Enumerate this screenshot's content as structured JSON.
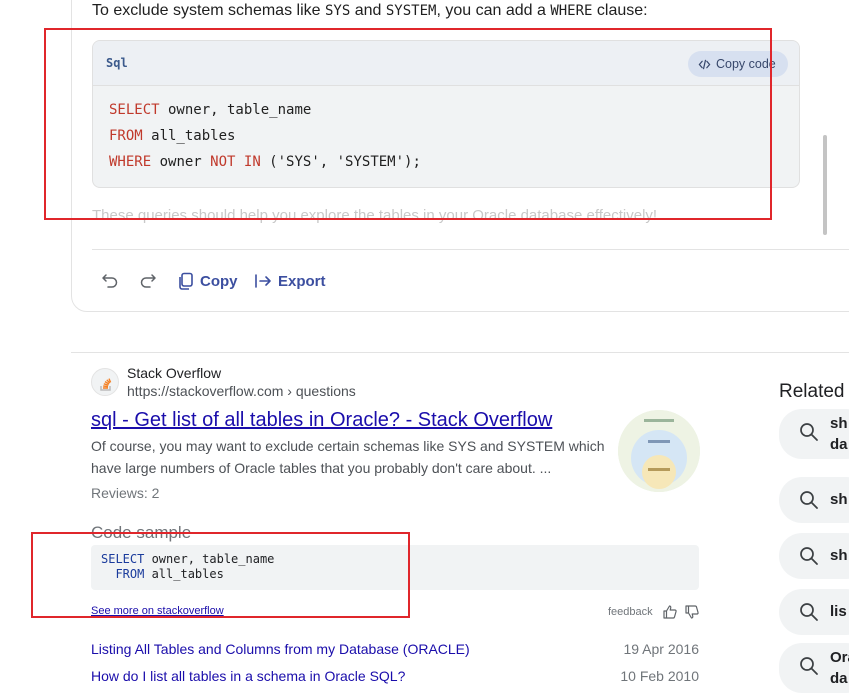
{
  "answer": {
    "intro_parts": [
      "To exclude system schemas like ",
      "SYS",
      " and ",
      "SYSTEM",
      ", you can add a ",
      "WHERE",
      " clause:"
    ],
    "code_language": "Sql",
    "copy_code_label": "Copy code",
    "code_lines": [
      [
        {
          "t": "SELECT",
          "k": true
        },
        {
          "t": " owner, table_name",
          "k": false
        }
      ],
      [
        {
          "t": "FROM",
          "k": true
        },
        {
          "t": " all_tables",
          "k": false
        }
      ],
      [
        {
          "t": "WHERE",
          "k": true
        },
        {
          "t": " owner ",
          "k": false
        },
        {
          "t": "NOT IN",
          "k": true
        },
        {
          "t": " ('SYS', 'SYSTEM');",
          "k": false
        }
      ]
    ],
    "faded_text": "These queries should help you explore the tables in your Oracle database effectively!",
    "copy_label": "Copy",
    "export_label": "Export"
  },
  "result": {
    "site_name": "Stack Overflow",
    "site_url": "https://stackoverflow.com › questions",
    "title": "sql - Get list of all tables in Oracle? - Stack Overflow",
    "snippet": "Of course, you may want to exclude certain schemas like SYS and SYSTEM which have large numbers of Oracle tables that you probably don't care about. ...",
    "reviews": "Reviews: 2",
    "code_sample_label": "Code sample",
    "sample_lines": [
      [
        {
          "t": "SELECT",
          "k": true
        },
        {
          "t": " owner, table_name",
          "k": false
        }
      ],
      [
        {
          "t": "  FROM",
          "k": true
        },
        {
          "t": " all_tables",
          "k": false
        }
      ]
    ],
    "see_more": "See more on stackoverflow",
    "feedback": "feedback",
    "related_questions": [
      {
        "title": "Listing All Tables and Columns from my Database (ORACLE)",
        "date": "19 Apr 2016"
      },
      {
        "title": "How do I list all tables in a schema in Oracle SQL?",
        "date": "10 Feb 2010"
      }
    ]
  },
  "related_panel": {
    "heading": "Related",
    "chips": [
      {
        "line1": "sh",
        "line2": "da"
      },
      {
        "line1": "sh",
        "line2": ""
      },
      {
        "line1": "sh",
        "line2": ""
      },
      {
        "line1": "lis",
        "line2": ""
      },
      {
        "line1": "Ora",
        "line2": "da"
      }
    ]
  },
  "colors": {
    "keyword": "#c0392b",
    "link": "#1a0dab",
    "action": "#3c4fa0",
    "annotation_box": "#e0262b"
  },
  "icons": [
    "undo-icon",
    "redo-icon",
    "copy-icon",
    "export-icon",
    "code-icon",
    "stackoverflow-favicon",
    "search-icon",
    "thumbs-up-icon",
    "thumbs-down-icon"
  ]
}
